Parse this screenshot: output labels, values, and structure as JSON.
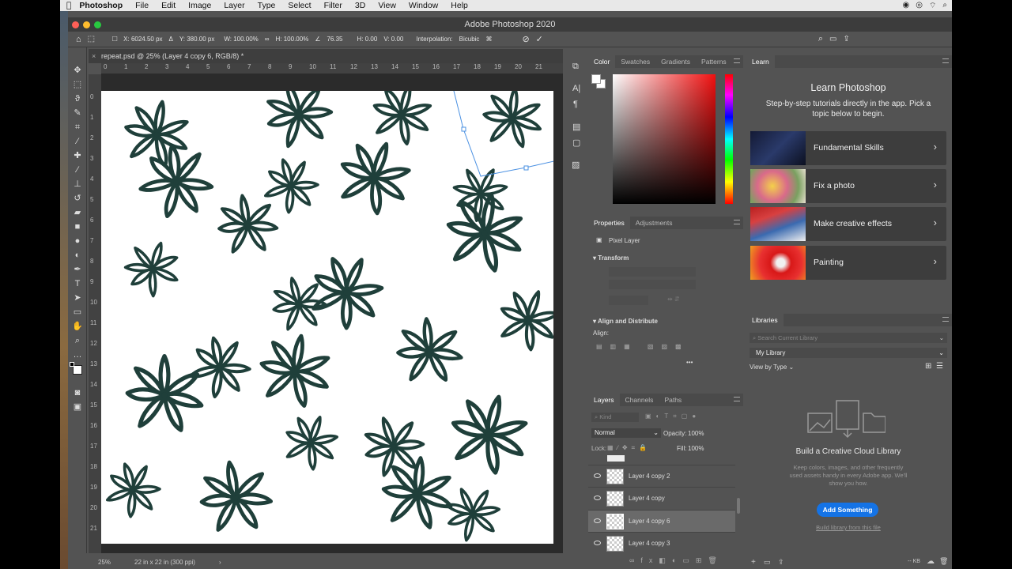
{
  "menubar": {
    "apple": "",
    "items": [
      "Photoshop",
      "File",
      "Edit",
      "Image",
      "Layer",
      "Type",
      "Select",
      "Filter",
      "3D",
      "View",
      "Window",
      "Help"
    ]
  },
  "titlebar": {
    "title": "Adobe Photoshop 2020"
  },
  "options": {
    "x": "X: 6024.50 px",
    "y": "Y: 380.00 px",
    "w": "W: 100.00%",
    "h": "H: 100.00%",
    "angle": "76.35",
    "hskew": "H: 0.00",
    "vskew": "V: 0.00",
    "interp_label": "Interpolation:",
    "interp_value": "Bicubic"
  },
  "document": {
    "tab": "repeat.psd @ 25% (Layer 4 copy 6, RGB/8) *",
    "zoom": "25%",
    "size": "22 in x 22 in (300 ppi)",
    "ruler_h": [
      "0",
      "1",
      "2",
      "3",
      "4",
      "5",
      "6",
      "7",
      "8",
      "9",
      "10",
      "11",
      "12",
      "13",
      "14",
      "15",
      "16",
      "17",
      "18",
      "19",
      "20",
      "21"
    ],
    "ruler_v": [
      "0",
      "1",
      "2",
      "3",
      "4",
      "5",
      "6",
      "7",
      "8",
      "9",
      "10",
      "11",
      "12",
      "13",
      "14",
      "15",
      "16",
      "17",
      "18",
      "19",
      "20",
      "21"
    ]
  },
  "color_panel": {
    "tabs": [
      "Color",
      "Swatches",
      "Gradients",
      "Patterns"
    ],
    "colors": {
      "hue": "#f01010",
      "brand": "#1473e6"
    }
  },
  "properties_panel": {
    "tabs": [
      "Properties",
      "Adjustments"
    ],
    "kind": "Pixel Layer",
    "transform": "Transform",
    "align_distribute": "Align and Distribute",
    "align": "Align:"
  },
  "layers_panel": {
    "tabs": [
      "Layers",
      "Channels",
      "Paths"
    ],
    "filter": "Kind",
    "blend": "Normal",
    "opacity_label": "Opacity:",
    "opacity": "100%",
    "lock": "Lock:",
    "fill_label": "Fill:",
    "fill": "100%",
    "layers": [
      {
        "name": "Layer 4 copy 2",
        "selected": false
      },
      {
        "name": "Layer 4 copy",
        "selected": false
      },
      {
        "name": "Layer 4 copy 6",
        "selected": true
      },
      {
        "name": "Layer 4 copy 3",
        "selected": false
      }
    ]
  },
  "learn_panel": {
    "tab": "Learn",
    "title": "Learn Photoshop",
    "subtitle": "Step-by-step tutorials directly in the app. Pick a topic below to begin.",
    "cards": [
      "Fundamental Skills",
      "Fix a photo",
      "Make creative effects",
      "Painting"
    ]
  },
  "libraries_panel": {
    "tab": "Libraries",
    "search": "Search Current Library",
    "library": "My Library",
    "view": "View by Type",
    "empty_title": "Build a Creative Cloud Library",
    "empty_desc": "Keep colors, images, and other frequently used assets handy in every Adobe app. We'll show you how.",
    "add_button": "Add Something",
    "link": "Build library from this file",
    "storage": "-- KB"
  }
}
